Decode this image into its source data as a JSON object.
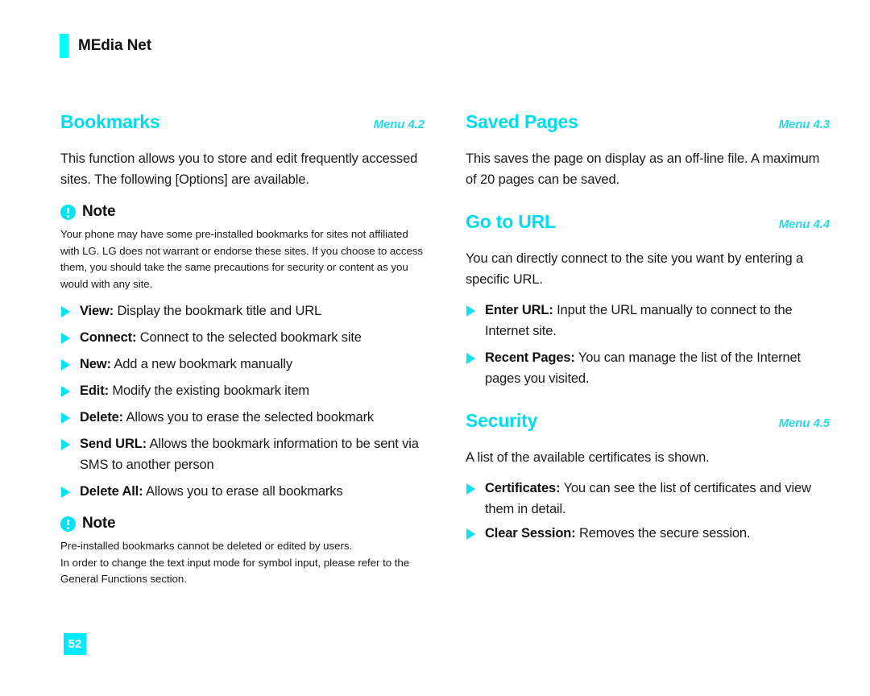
{
  "header": {
    "title": "MEdia Net"
  },
  "page_number": "52",
  "colors": {
    "accent": "#00FFFF",
    "heading": "#00DDEE",
    "text": "#1A1A1A"
  },
  "left_column": {
    "section": {
      "title": "Bookmarks",
      "menu": "Menu 4.2"
    },
    "intro": "This function allows you to store and edit frequently accessed sites. The following [Options] are available.",
    "note_1": {
      "title": "Note",
      "body": "Your phone may have some pre-installed bookmarks for sites not affiliated with LG. LG does not warrant or endorse these sites. If you choose to access them, you should take the same precautions for security or content as you would with any site."
    },
    "options": [
      {
        "label": "View:",
        "text": "Display the bookmark title and URL"
      },
      {
        "label": "Connect:",
        "text": "Connect to the selected bookmark site"
      },
      {
        "label": "New:",
        "text": "Add a new bookmark manually"
      },
      {
        "label": "Edit:",
        "text": "Modify the existing bookmark item"
      },
      {
        "label": "Delete:",
        "text": "Allows you to erase the selected bookmark"
      },
      {
        "label": "Send URL:",
        "text": "Allows the bookmark information to be sent via SMS to another person"
      },
      {
        "label": "Delete All:",
        "text": "Allows you to erase all bookmarks"
      }
    ],
    "note_2": {
      "title": "Note",
      "body_line_1": "Pre-installed bookmarks cannot be deleted or edited by users.",
      "body_line_2": "In order to change the text input mode for symbol input, please refer to the General Functions section."
    }
  },
  "right_column": {
    "saved_pages": {
      "title": "Saved Pages",
      "menu": "Menu 4.3",
      "body": "This saves  the page on display as an off-line file. A maximum of 20 pages can be saved."
    },
    "go_to_url": {
      "title": "Go to URL",
      "menu": "Menu 4.4",
      "body": "You can directly connect to the site you want by entering a specific URL.",
      "options": [
        {
          "label": "Enter URL:",
          "text": "Input the URL manually to connect to the Internet site."
        },
        {
          "label": "Recent Pages:",
          "text": "You can manage the list of the Internet pages you visited."
        }
      ]
    },
    "security": {
      "title": "Security",
      "menu": "Menu 4.5",
      "body": "A list of the available certificates is shown.",
      "options": [
        {
          "label": "Certificates:",
          "text": "You can see the list of certificates and view them in detail."
        },
        {
          "label": "Clear Session:",
          "text": "Removes the secure session."
        }
      ]
    }
  }
}
